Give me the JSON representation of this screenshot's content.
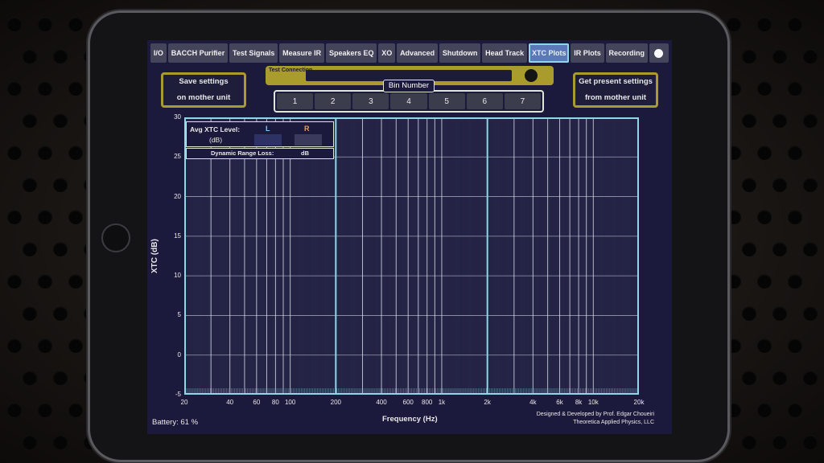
{
  "tabs": [
    {
      "label": "I/O",
      "active": false
    },
    {
      "label": "BACCH Purifier",
      "active": false
    },
    {
      "label": "Test Signals",
      "active": false
    },
    {
      "label": "Measure IR",
      "active": false
    },
    {
      "label": "Speakers EQ",
      "active": false
    },
    {
      "label": "XO",
      "active": false
    },
    {
      "label": "Advanced",
      "active": false
    },
    {
      "label": "Shutdown",
      "active": false
    },
    {
      "label": "Head Track",
      "active": false
    },
    {
      "label": "XTC Plots",
      "active": true
    },
    {
      "label": "IR Plots",
      "active": false
    },
    {
      "label": "Recording",
      "active": false
    }
  ],
  "save_button": {
    "line1": "Save settings",
    "line2": "on mother unit"
  },
  "get_button": {
    "line1": "Get present settings",
    "line2": "from mother unit"
  },
  "test_connection": {
    "label": "Test Connection"
  },
  "bins": {
    "label": "Bin Number",
    "items": [
      "1",
      "2",
      "3",
      "4",
      "5",
      "6",
      "7"
    ]
  },
  "avg_xtc": {
    "label": "Avg XTC Level:",
    "unit": "(dB)",
    "left": "L",
    "right": "R"
  },
  "dynamic_range": {
    "label": "Dynamic Range Loss:",
    "unit": "dB"
  },
  "footer": {
    "battery": "Battery: 61 %",
    "credit_line1": "Designed & Developed by Prof. Edgar Choueiri",
    "credit_line2": "Theoretica Applied Physics, LLC"
  },
  "colors": {
    "accent_gold": "#a99b2c",
    "plot_border": "#8fd6e8",
    "screen_bg": "#1b1a3c",
    "active_tab": "#5b78b8"
  },
  "chart_data": {
    "type": "line",
    "title": "",
    "xlabel": "Frequency (Hz)",
    "ylabel": "XTC (dB)",
    "xscale": "log",
    "xlim": [
      20,
      20000
    ],
    "ylim": [
      -5,
      30
    ],
    "yticks": [
      -5,
      0,
      5,
      10,
      15,
      20,
      25,
      30
    ],
    "xticks": [
      {
        "value": 20,
        "label": "20"
      },
      {
        "value": 40,
        "label": "40"
      },
      {
        "value": 60,
        "label": "60"
      },
      {
        "value": 80,
        "label": "80"
      },
      {
        "value": 100,
        "label": "100"
      },
      {
        "value": 200,
        "label": "200"
      },
      {
        "value": 400,
        "label": "400"
      },
      {
        "value": 600,
        "label": "600"
      },
      {
        "value": 800,
        "label": "800"
      },
      {
        "value": 1000,
        "label": "1k"
      },
      {
        "value": 2000,
        "label": "2k"
      },
      {
        "value": 4000,
        "label": "4k"
      },
      {
        "value": 6000,
        "label": "6k"
      },
      {
        "value": 8000,
        "label": "8k"
      },
      {
        "value": 10000,
        "label": "10k"
      },
      {
        "value": 20000,
        "label": "20k"
      }
    ],
    "bin_boundaries": [
      200,
      2000
    ],
    "grid": true,
    "series": []
  }
}
